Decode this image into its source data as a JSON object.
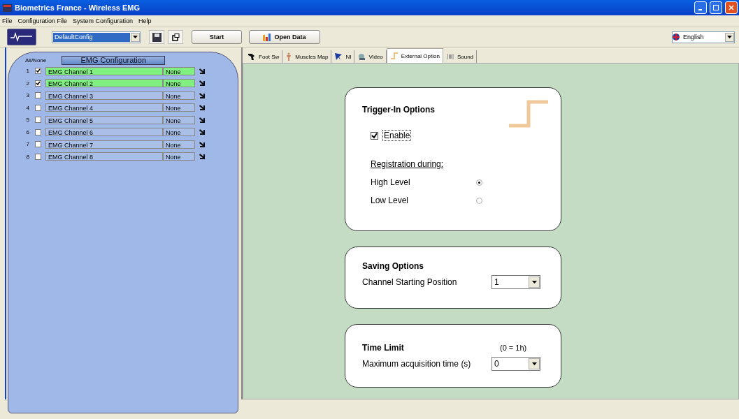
{
  "window": {
    "title": "Biometrics France - Wireless EMG"
  },
  "menu": [
    "File",
    "Configuration File",
    "System Configuration",
    "Help"
  ],
  "toolbar": {
    "config": "DefaultConfig",
    "start": "Start",
    "open_data": "Open Data",
    "language": "English"
  },
  "emg_panel": {
    "all_none": "All/None",
    "title": "EMG Configuration",
    "channels": [
      {
        "number": "1",
        "checked": true,
        "name": "EMG Channel 1",
        "muscle": "None"
      },
      {
        "number": "2",
        "checked": true,
        "name": "EMG Channel 2",
        "muscle": "None"
      },
      {
        "number": "3",
        "checked": false,
        "name": "EMG Channel 3",
        "muscle": "None"
      },
      {
        "number": "4",
        "checked": false,
        "name": "EMG Channel 4",
        "muscle": "None"
      },
      {
        "number": "5",
        "checked": false,
        "name": "EMG Channel 5",
        "muscle": "None"
      },
      {
        "number": "6",
        "checked": false,
        "name": "EMG Channel 6",
        "muscle": "None"
      },
      {
        "number": "7",
        "checked": false,
        "name": "EMG Channel 7",
        "muscle": "None"
      },
      {
        "number": "8",
        "checked": false,
        "name": "EMG Channel 8",
        "muscle": "None"
      }
    ]
  },
  "tabs": [
    {
      "label": "Foot Sw",
      "kind": "foot",
      "selected": false
    },
    {
      "label": "Muscles Map",
      "kind": "body",
      "selected": false
    },
    {
      "label": "NI",
      "kind": "ni",
      "selected": false
    },
    {
      "label": "Video",
      "kind": "video",
      "selected": false
    },
    {
      "label": "External Option",
      "kind": "step",
      "selected": true
    },
    {
      "label": "Sound",
      "kind": "sound",
      "selected": false
    }
  ],
  "trigger": {
    "title": "Trigger-In Options",
    "enable": {
      "label": "Enable",
      "checked": true
    },
    "registration_label": "Registration during:",
    "options": [
      {
        "label": "High Level",
        "selected": true
      },
      {
        "label": "Low Level",
        "selected": false
      }
    ]
  },
  "saving": {
    "title": "Saving Options",
    "label": "Channel Starting Position",
    "value": "1"
  },
  "time_limit": {
    "title": "Time Limit",
    "note": "(0 = 1h)",
    "label": "Maximum acquisition time (s)",
    "value": "0"
  }
}
